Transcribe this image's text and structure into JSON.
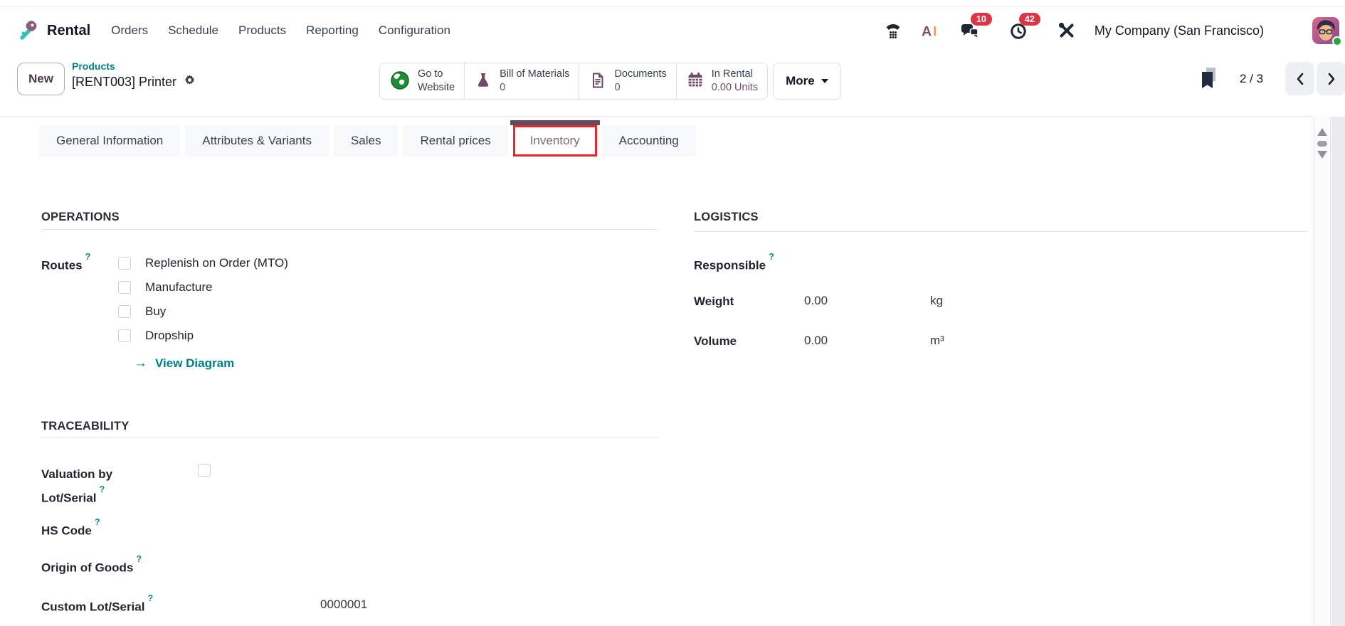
{
  "navbar": {
    "app_name": "Rental",
    "menus": [
      "Orders",
      "Schedule",
      "Products",
      "Reporting",
      "Configuration"
    ],
    "messages_badge": "10",
    "activities_badge": "42",
    "company_name": "My Company (San Francisco)"
  },
  "control_panel": {
    "new_button_label": "New",
    "breadcrumb": {
      "parent": "Products",
      "current": "[RENT003] Printer"
    },
    "smart_buttons": [
      {
        "line1": "Go to",
        "line2": "Website"
      },
      {
        "line1": "Bill of Materials",
        "line2": "0"
      },
      {
        "line1": "Documents",
        "line2": "0"
      },
      {
        "line1": "In Rental",
        "line2": "0.00 Units"
      }
    ],
    "more_label": "More",
    "pager": "2 / 3"
  },
  "tabs": {
    "items": [
      "General Information",
      "Attributes & Variants",
      "Sales",
      "Rental prices",
      "Inventory",
      "Accounting"
    ],
    "active": "Inventory"
  },
  "form": {
    "help_marker": "?",
    "operations": {
      "title": "OPERATIONS",
      "routes_label": "Routes",
      "route_options": [
        "Replenish on Order (MTO)",
        "Manufacture",
        "Buy",
        "Dropship"
      ],
      "view_diagram_label": "View Diagram",
      "view_diagram_arrow": "→"
    },
    "logistics": {
      "title": "LOGISTICS",
      "responsible_label": "Responsible",
      "weight_label": "Weight",
      "weight_value": "0.00",
      "weight_unit": "kg",
      "volume_label": "Volume",
      "volume_value": "0.00",
      "volume_unit": "m³"
    },
    "traceability": {
      "title": "TRACEABILITY",
      "valuation_label": "Valuation by Lot/Serial",
      "hs_code_label": "HS Code",
      "origin_label": "Origin of Goods",
      "custom_lot_label": "Custom Lot/Serial",
      "custom_lot_value": "0000001"
    }
  },
  "colors": {
    "brand_purple": "#714B67",
    "link_teal": "#017E84",
    "badge_red": "#DC3545",
    "annotation_red": "#E8262D"
  }
}
